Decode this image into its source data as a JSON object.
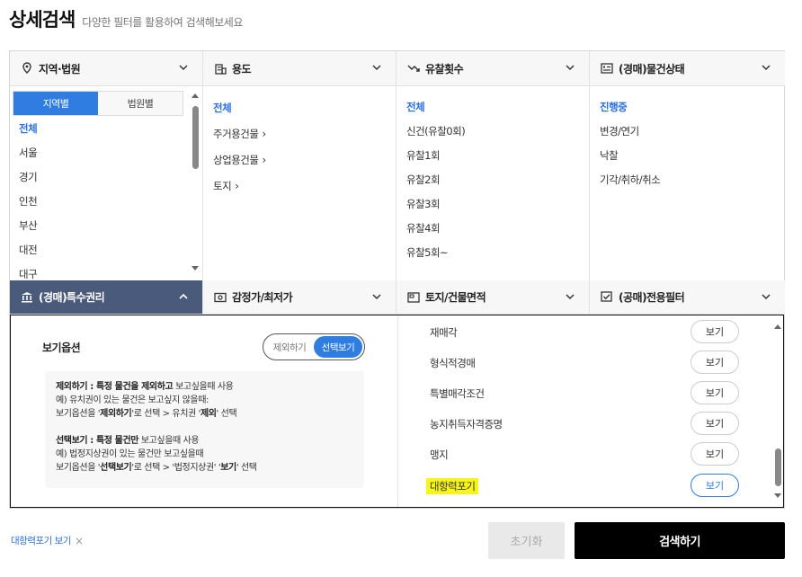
{
  "header": {
    "title": "상세검색",
    "subtitle": "다양한 필터를 활용하여 검색해보세요"
  },
  "columns": {
    "region": {
      "label": "지역·법원",
      "tabs": [
        "지역별",
        "법원별"
      ],
      "items": [
        "전체",
        "서울",
        "경기",
        "인천",
        "부산",
        "대전",
        "대구"
      ]
    },
    "usage": {
      "label": "용도",
      "items": [
        "전체",
        "주거용건물",
        "상업용건물",
        "토지"
      ]
    },
    "failcount": {
      "label": "유찰횟수",
      "items": [
        "전체",
        "신건(유찰0회)",
        "유찰1회",
        "유찰2회",
        "유찰3회",
        "유찰4회",
        "유찰5회~"
      ]
    },
    "status": {
      "label": "(경매)물건상태",
      "items": [
        "진행중",
        "변경/연기",
        "낙찰",
        "기각/취하/취소"
      ]
    }
  },
  "row2": {
    "special": "(경매)특수권리",
    "price": "감정가/최저가",
    "area": "토지/건물면적",
    "public": "(공매)전용필터"
  },
  "special_panel": {
    "view_option_label": "보기옵션",
    "toggle_exclude": "제외하기",
    "toggle_select": "선택보기",
    "help": {
      "l1_bold": "제외하기 : 특정 물건을 제외하고",
      "l1_rest": " 보고싶을때 사용",
      "l2": "예) 유치권이 있는 물건은 보고싶지 않을때:",
      "l3a": "보기옵션을 '",
      "l3b": "제외하기",
      "l3c": "'로 선택 > 유치권 '",
      "l3d": "제외",
      "l3e": "' 선택",
      "l4_bold": "선택보기 : 특정 물건만",
      "l4_rest": " 보고싶을때 사용",
      "l5": "예) 법정지상권이 있는 물건만 보고싶을때",
      "l6a": "보기옵션을 '",
      "l6b": "선택보기",
      "l6c": "'로 선택 > '법정지상권' '",
      "l6d": "보기",
      "l6e": "' 선택"
    },
    "items": [
      "재매각",
      "형식적경매",
      "특별매각조건",
      "농지취득자격증명",
      "맹지",
      "대항력포기"
    ],
    "view_btn": "보기"
  },
  "footer": {
    "selected_tag": "대항력포기 보기",
    "reset": "초기화",
    "search": "검색하기"
  }
}
